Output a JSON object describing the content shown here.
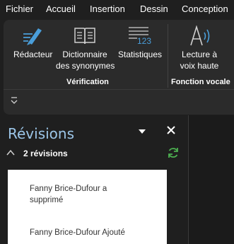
{
  "menu": [
    "Fichier",
    "Accueil",
    "Insertion",
    "Dessin",
    "Conception"
  ],
  "ribbon": {
    "verification": {
      "group_label": "Vérification",
      "commands": [
        {
          "label": "Rédacteur",
          "icon": "editor-pen-icon"
        },
        {
          "label_line1": "Dictionnaire",
          "label_line2": "des synonymes",
          "icon": "thesaurus-book-icon"
        },
        {
          "label": "Statistiques",
          "icon": "word-count-icon"
        }
      ]
    },
    "voice": {
      "group_label": "Fonction vocale",
      "command": {
        "label_line1": "Lecture à",
        "label_line2": "voix haute",
        "icon": "read-aloud-icon"
      }
    },
    "word_count_badge": "123"
  },
  "revisions": {
    "title": "Révisions",
    "count": "2 révisions",
    "items": [
      {
        "line1": "Fanny Brice-Dufour a",
        "line2": "supprimé"
      },
      {
        "line1": "Fanny Brice-Dufour Ajouté",
        "line2": ""
      }
    ]
  },
  "colors": {
    "accent": "#9cc6e8",
    "refresh": "#4caf50",
    "icon_blue": "#4a9eda"
  }
}
